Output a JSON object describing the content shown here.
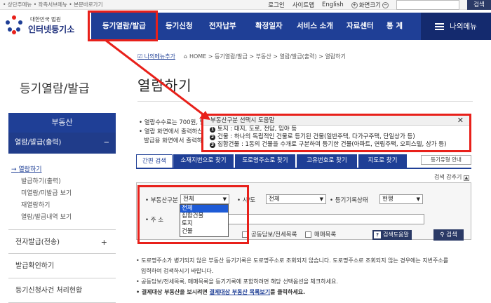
{
  "util": {
    "skip_links": "• 상단주메뉴 • 좌측서브메뉴 • 본문바로가기",
    "login": "로그인",
    "sitemap": "사이트맵",
    "english": "English",
    "font_size": "화면크기",
    "font_plus": "+",
    "font_minus": "−",
    "search_button": "검색"
  },
  "logo": {
    "line1": "대한민국 법원",
    "line2": "인터넷등기소"
  },
  "gnb": {
    "items": [
      "등기열람/발급",
      "등기신청",
      "전자납부",
      "확정일자",
      "서비스 소개",
      "자료센터",
      "통 계"
    ],
    "my_menu": "나의메뉴"
  },
  "lnb": {
    "title": "등기열람/발급",
    "section": "부동산",
    "selected": "열람/발급(출력)",
    "minus": "−",
    "sub_items": [
      "열람하기",
      "발급하기(출력)",
      "미열람/미발급 보기",
      "재열람하기",
      "열람/발급내역 보기"
    ],
    "menus": [
      "전자발급(전송)",
      "발급확인하기",
      "등기신청사건 처리현황"
    ],
    "plus": "+"
  },
  "breadcrumb": {
    "favorite": "나의메뉴추가",
    "path": "HOME > 등기열람/발급 > 부동산 > 열람/발급(출력) > 열람하기"
  },
  "page_title": "열람하기",
  "notices": [
    "• 열람수수료는 700원, 발",
    "• 열람 화면에서 출력하신",
    "발급용 화면에서 출력하시"
  ],
  "tabs": [
    "간편 검색",
    "소재지번으로 찾기",
    "도로명주소로 찾기",
    "고유번호로 찾기",
    "지도로 찾기"
  ],
  "favorites_button": "등기유형 안내",
  "hide_search": "검색 감추기",
  "form": {
    "property_type_label": "• 부동산구분",
    "property_type_value": "전체",
    "dropdown_options": [
      "전체",
      "집합건물",
      "토지",
      "건물"
    ],
    "sido_label": "• 시/도",
    "sido_value": "전체",
    "status_label": "• 등기기록상태",
    "status_value": "현행",
    "address_label": "• 주 소",
    "check1": "공동담보/전세목록",
    "check2": "매매목록",
    "help_button": "검색도움말",
    "help_icon": "?",
    "search_button": "검색"
  },
  "bottom_notes": [
    "• 도로명주소가 병기되지 않은 부동산 등기기록은 도로명주소로 조회되지 않습니다. 도로명주소로 조회되지 않는 경우에는 지번주소를",
    "입력하여 검색하시기 바랍니다.",
    "• 공동담보/전세목록, 매매목록을 등기기록에 포함하려면 해당 선택옵션을 체크하세요.",
    "• 결제대상 부동산을 보시려면 ",
    "결제대상 부동산 목록보기",
    "를 클릭하세요."
  ],
  "popup": {
    "title": "부동산구분 선택시 도움말",
    "close": "✕",
    "lines": [
      {
        "num": "1",
        "text": "토지 : 대지, 도로, 전답, 임야 등"
      },
      {
        "num": "2",
        "text": "건물 : 하나의 독립적인 건물로 등기된 건물(일반주택, 다가구주택, 단일상가 등)"
      },
      {
        "num": "3",
        "text": "집합건물 : 1동의 건물을 수개로 구분하여 등기한 건물(아파트, 연립주택, 오피스텔, 상가 등)"
      }
    ]
  },
  "colors": {
    "navy": "#1f3f96",
    "highlight": "#e8201a"
  }
}
